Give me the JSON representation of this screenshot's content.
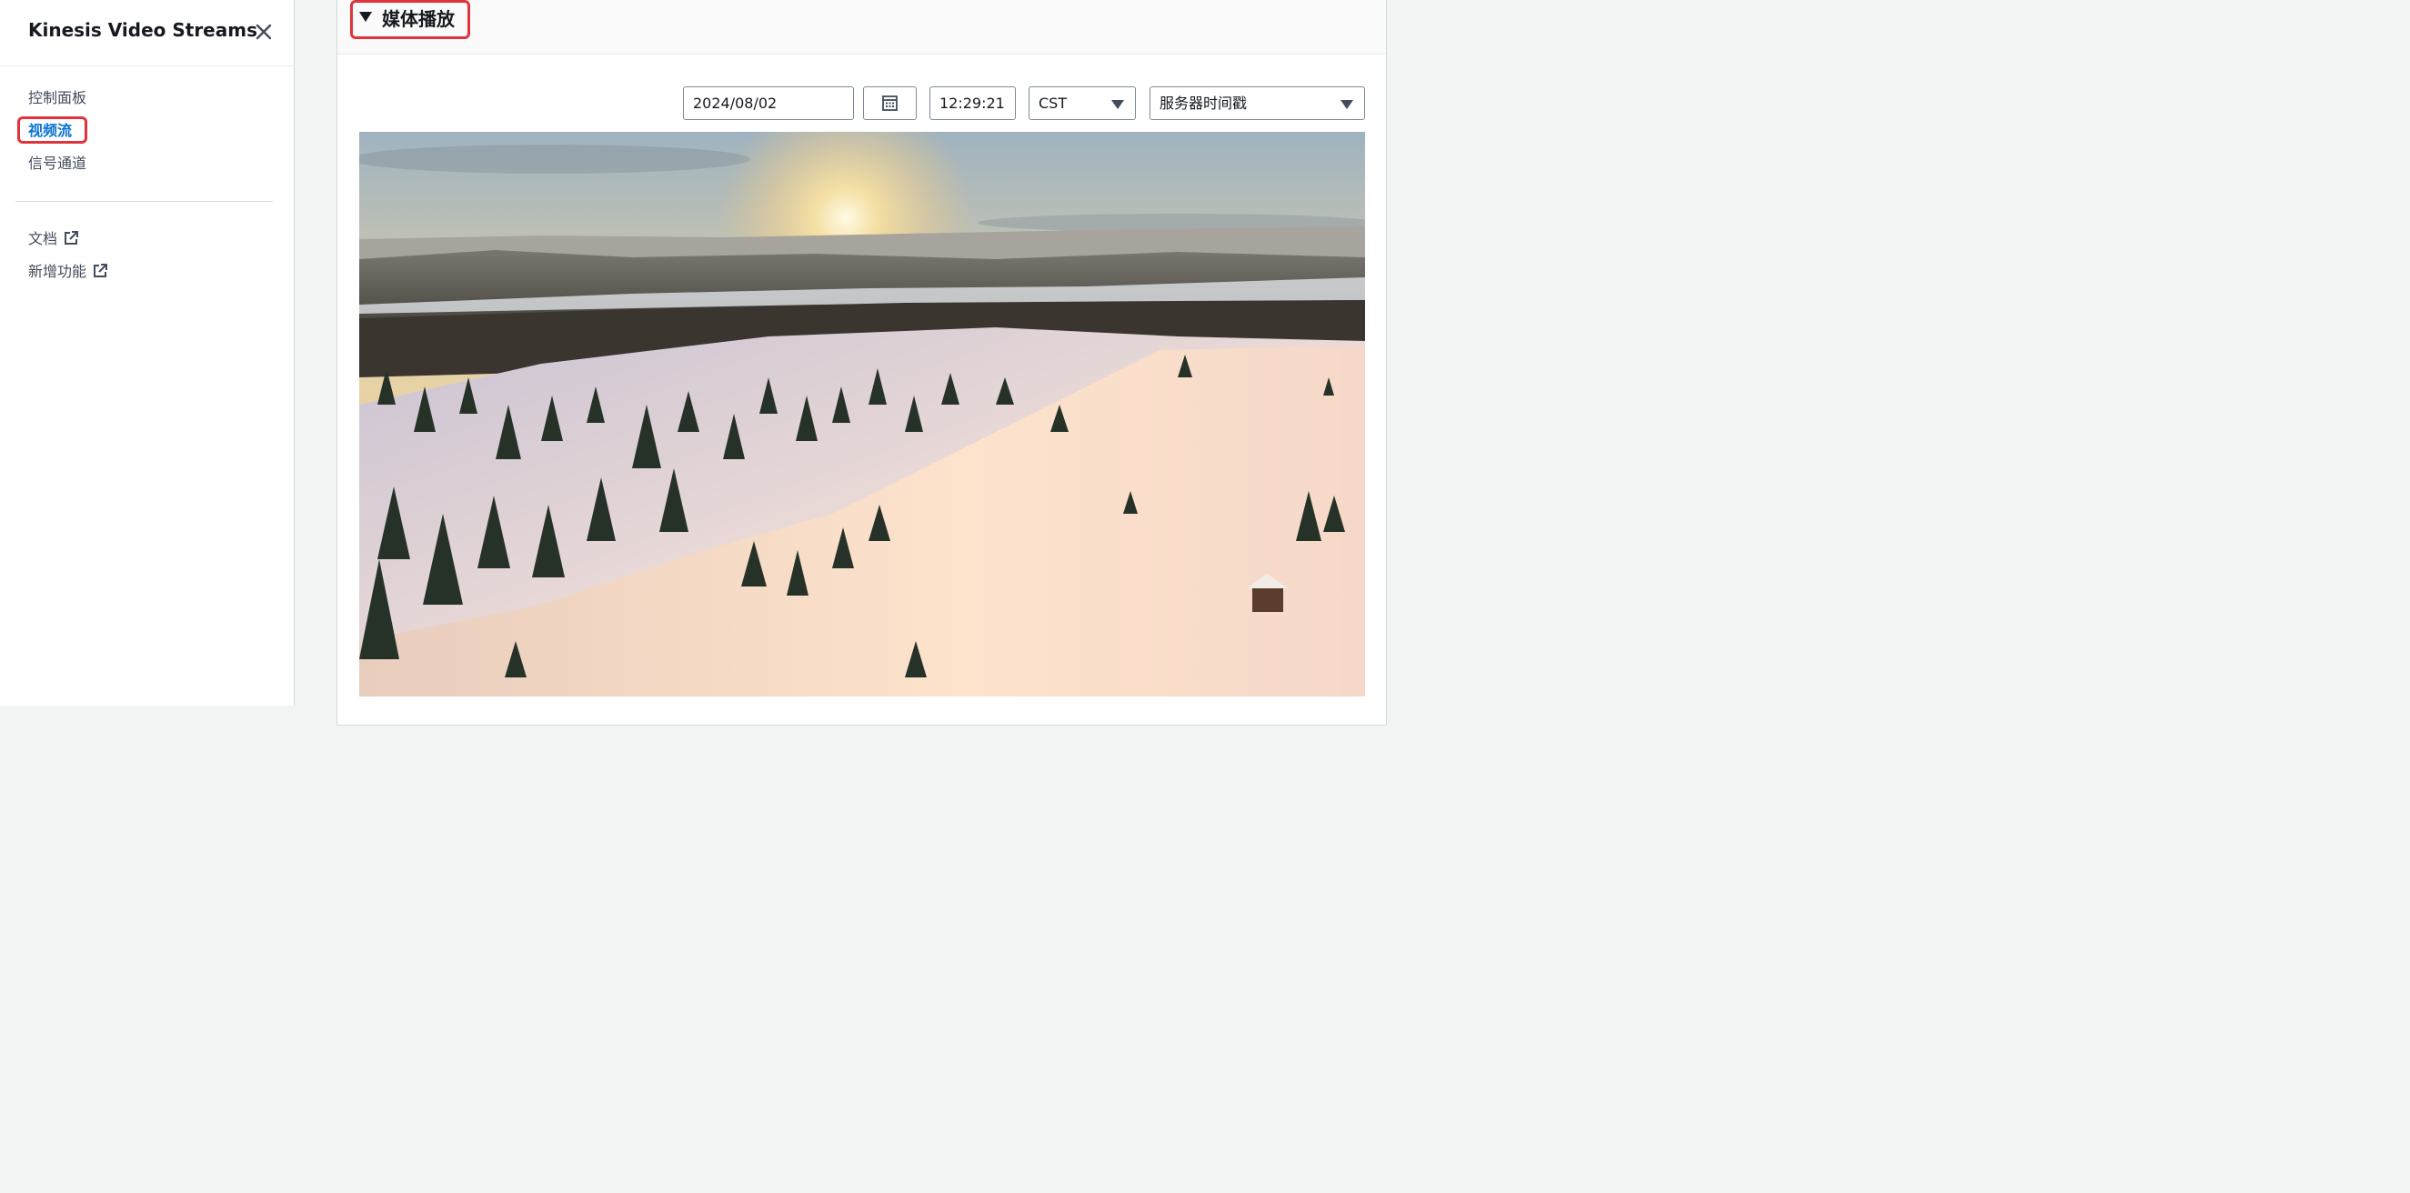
{
  "sidebar": {
    "title": "Kinesis Video Streams",
    "nav_items": [
      {
        "label": "控制面板",
        "active": false
      },
      {
        "label": "视频流",
        "active": true
      },
      {
        "label": "信号通道",
        "active": false
      }
    ],
    "external_links": [
      {
        "label": "文档",
        "icon": "external-link-icon"
      },
      {
        "label": "新增功能",
        "icon": "external-link-icon"
      }
    ]
  },
  "main": {
    "section": {
      "title": "媒体播放",
      "expanded": true
    },
    "controls": {
      "date_value": "2024/08/02",
      "time_value": "12:29:21",
      "timezone": "CST",
      "timestamp_type": "服务器时间戳"
    },
    "video": {
      "content": "snowy-forest-sunset-aerial"
    }
  },
  "colors": {
    "accent": "#0972d3",
    "highlight": "#e0343b",
    "text": "#16191f",
    "border": "#7d8998"
  }
}
